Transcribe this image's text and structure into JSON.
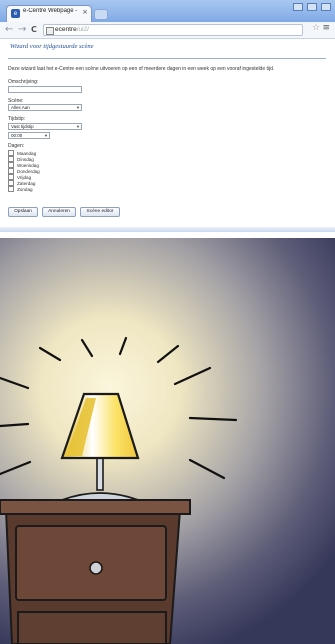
{
  "browser": {
    "tab_title": "e-Centre Webpage - Spe",
    "tab_close": "×",
    "url_host": "ecentre",
    "url_path": "/ui2/",
    "back": "←",
    "forward": "→",
    "reload": "C",
    "star": "☆",
    "menu": "≡"
  },
  "wizard": {
    "title": "Wizard voor tijdgestuurde scène",
    "intro": "Deze wizard laat het e-Centre een scène uitvoeren op een of meerdere dagen in een week op een vooraf ingestelde tijd.",
    "omschrijving_label": "Omschrijving:",
    "omschrijving_value": "",
    "scene_label": "Scène:",
    "scene_value": "Alles Aan",
    "tijdstip_label": "Tijdstip:",
    "tijdstip_value": "Vast tijdstip",
    "time_value": "00:00",
    "dagen_label": "Dagen:",
    "days": [
      "Maandag",
      "Dinsdag",
      "Woensdag",
      "Donderdag",
      "Vrijdag",
      "Zaterdag",
      "Zondag"
    ],
    "buttons": {
      "opslaan": "Opslaan",
      "annuleren": "Annuleren",
      "scene_editor": "Scène editor"
    }
  },
  "colors": {
    "titlebar": "#8fb4ea",
    "link_blue": "#1e4e9a",
    "wall_glow": "#f4ecc8",
    "wall_dark": "#3b3d5a",
    "lamp_shade": "#f5d84a",
    "nightstand": "#5b3a2c"
  },
  "icons": {
    "favicon": "page-icon",
    "back": "back-arrow-icon",
    "forward": "forward-arrow-icon",
    "reload": "reload-icon",
    "star": "star-icon",
    "menu": "menu-icon"
  }
}
